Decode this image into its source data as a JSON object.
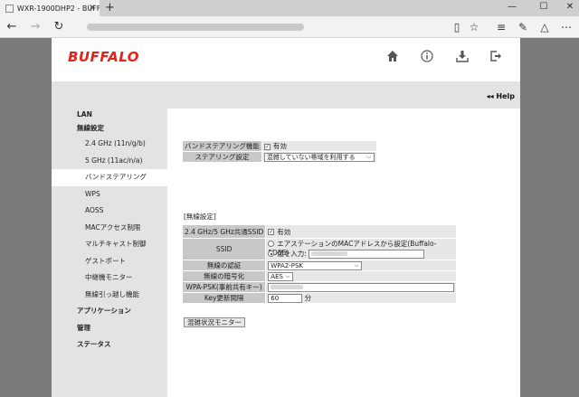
{
  "browser": {
    "tab_title": "WXR-1900DHP2 - BUFF",
    "window_buttons": [
      "—",
      "☐",
      "✕"
    ]
  },
  "header": {
    "logo": "BUFFALO",
    "icons": [
      "home-icon",
      "info-icon",
      "download-icon",
      "logout-icon"
    ]
  },
  "help": "◂◂ Help",
  "sidebar": {
    "items": [
      {
        "label": "LAN",
        "level": "top"
      },
      {
        "label": "無線設定",
        "level": "top"
      },
      {
        "label": "2.4 GHz (11n/g/b)",
        "level": "sub"
      },
      {
        "label": "5 GHz (11ac/n/a)",
        "level": "sub"
      },
      {
        "label": "バンドステアリング",
        "level": "sub",
        "active": true
      },
      {
        "label": "WPS",
        "level": "sub"
      },
      {
        "label": "AOSS",
        "level": "sub"
      },
      {
        "label": "MACアクセス制限",
        "level": "sub"
      },
      {
        "label": "マルチキャスト制御",
        "level": "sub"
      },
      {
        "label": "ゲストポート",
        "level": "sub"
      },
      {
        "label": "中継機モニター",
        "level": "sub"
      },
      {
        "label": "無線引っ越し機能",
        "level": "sub"
      },
      {
        "label": "アプリケーション",
        "level": "top"
      },
      {
        "label": "管理",
        "level": "top"
      },
      {
        "label": "ステータス",
        "level": "top"
      }
    ]
  },
  "band": {
    "func_label": "バンドステアリング機能",
    "func_value": "有効",
    "setting_label": "ステアリング設定",
    "setting_value": "混雑していない帯域を利用する"
  },
  "wireless": {
    "section_title": "[無線設定]",
    "common_ssid_label": "2.4 GHz/5 GHz共通SSID",
    "common_ssid_value": "有効",
    "ssid_label": "SSID",
    "ssid_option1": "エアステーションのMACアドレスから設定(Buffalo-5D5E)",
    "ssid_option2": "値を入力:",
    "auth_label": "無線の認証",
    "auth_value": "WPA2-PSK",
    "enc_label": "無線の暗号化",
    "enc_value": "AES",
    "psk_label": "WPA-PSK(事前共有キー)",
    "interval_label": "Key更新間隔",
    "interval_value": "60",
    "interval_unit": "分"
  },
  "monitor_button": "混雑状況モニター"
}
